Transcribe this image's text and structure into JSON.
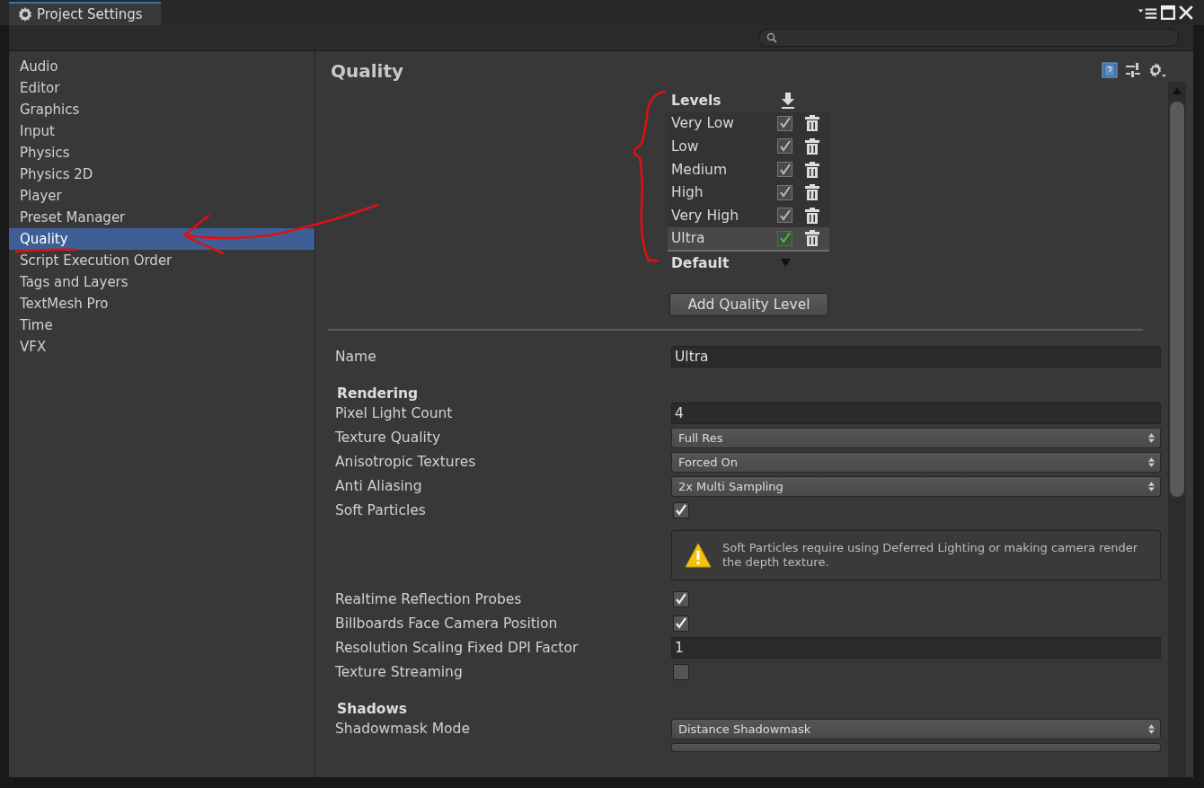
{
  "window": {
    "title": "Project Settings"
  },
  "sidebar": {
    "items": [
      {
        "label": "Audio",
        "selected": false
      },
      {
        "label": "Editor",
        "selected": false
      },
      {
        "label": "Graphics",
        "selected": false
      },
      {
        "label": "Input",
        "selected": false
      },
      {
        "label": "Physics",
        "selected": false
      },
      {
        "label": "Physics 2D",
        "selected": false
      },
      {
        "label": "Player",
        "selected": false
      },
      {
        "label": "Preset Manager",
        "selected": false
      },
      {
        "label": "Quality",
        "selected": true
      },
      {
        "label": "Script Execution Order",
        "selected": false
      },
      {
        "label": "Tags and Layers",
        "selected": false
      },
      {
        "label": "TextMesh Pro",
        "selected": false
      },
      {
        "label": "Time",
        "selected": false
      },
      {
        "label": "VFX",
        "selected": false
      }
    ]
  },
  "panel": {
    "title": "Quality",
    "levels": {
      "header": "Levels",
      "items": [
        {
          "name": "Very Low",
          "checked": true,
          "selected": false
        },
        {
          "name": "Low",
          "checked": true,
          "selected": false
        },
        {
          "name": "Medium",
          "checked": true,
          "selected": false
        },
        {
          "name": "High",
          "checked": true,
          "selected": false
        },
        {
          "name": "Very High",
          "checked": true,
          "selected": false
        },
        {
          "name": "Ultra",
          "checked": true,
          "selected": true
        }
      ],
      "default_label": "Default",
      "add_button": "Add Quality Level"
    },
    "settings": [
      {
        "kind": "field",
        "label": "Name",
        "value": "Ultra"
      },
      {
        "kind": "heading",
        "label": "Rendering"
      },
      {
        "kind": "field",
        "label": "Pixel Light Count",
        "value": "4"
      },
      {
        "kind": "dropdown",
        "label": "Texture Quality",
        "value": "Full Res"
      },
      {
        "kind": "dropdown",
        "label": "Anisotropic Textures",
        "value": "Forced On"
      },
      {
        "kind": "dropdown",
        "label": "Anti Aliasing",
        "value": "2x Multi Sampling"
      },
      {
        "kind": "checkbox",
        "label": "Soft Particles",
        "checked": true
      },
      {
        "kind": "warning",
        "text": "Soft Particles require using Deferred Lighting or making camera render the depth texture."
      },
      {
        "kind": "checkbox",
        "label": "Realtime Reflection Probes",
        "checked": true
      },
      {
        "kind": "checkbox",
        "label": "Billboards Face Camera Position",
        "checked": true
      },
      {
        "kind": "field",
        "label": "Resolution Scaling Fixed DPI Factor",
        "value": "1"
      },
      {
        "kind": "checkbox",
        "label": "Texture Streaming",
        "checked": false
      },
      {
        "kind": "heading",
        "label": "Shadows"
      },
      {
        "kind": "dropdown",
        "label": "Shadowmask Mode",
        "value": "Distance Shadowmask"
      }
    ]
  }
}
